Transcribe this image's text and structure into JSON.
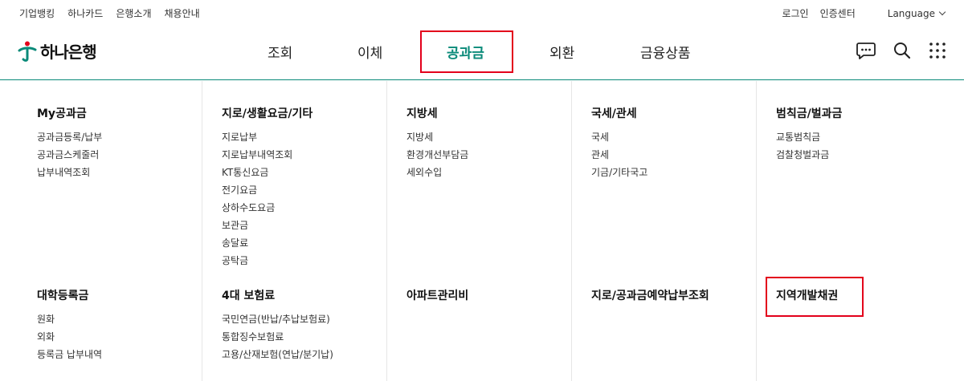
{
  "top_links": [
    "기업뱅킹",
    "하나카드",
    "은행소개",
    "채용안내"
  ],
  "util_links": [
    "로그인",
    "인증센터"
  ],
  "language": "Language",
  "logo_text": "하나은행",
  "gnb": [
    "조회",
    "이체",
    "공과금",
    "외환",
    "금융상품"
  ],
  "gnb_active": "공과금",
  "accent_color": "#0a8a79",
  "highlight_color": "#e3001b",
  "menu": [
    {
      "title": "My공과금",
      "items": [
        "공과금등록/납부",
        "공과금스케줄러",
        "납부내역조회"
      ]
    },
    {
      "title": "지로/생활요금/기타",
      "items": [
        "지로납부",
        "지로납부내역조회",
        "KT통신요금",
        "전기요금",
        "상하수도요금",
        "보관금",
        "송달료",
        "공탁금"
      ]
    },
    {
      "title": "지방세",
      "items": [
        "지방세",
        "환경개선부담금",
        "세외수입"
      ]
    },
    {
      "title": "국세/관세",
      "items": [
        "국세",
        "관세",
        "기금/기타국고"
      ]
    },
    {
      "title": "범칙금/벌과금",
      "items": [
        "교통범칙금",
        "검찰청벌과금"
      ]
    },
    {
      "title": "대학등록금",
      "items": [
        "원화",
        "외화",
        "등록금 납부내역"
      ]
    },
    {
      "title": "4대 보험료",
      "items": [
        "국민연금(반납/추납보험료)",
        "통합징수보험료",
        "고용/산재보험(연납/분기납)"
      ]
    },
    {
      "title": "아파트관리비",
      "items": []
    },
    {
      "title": "지로/공과금예약납부조회",
      "items": []
    },
    {
      "title": "지역개발채권",
      "items": []
    }
  ]
}
